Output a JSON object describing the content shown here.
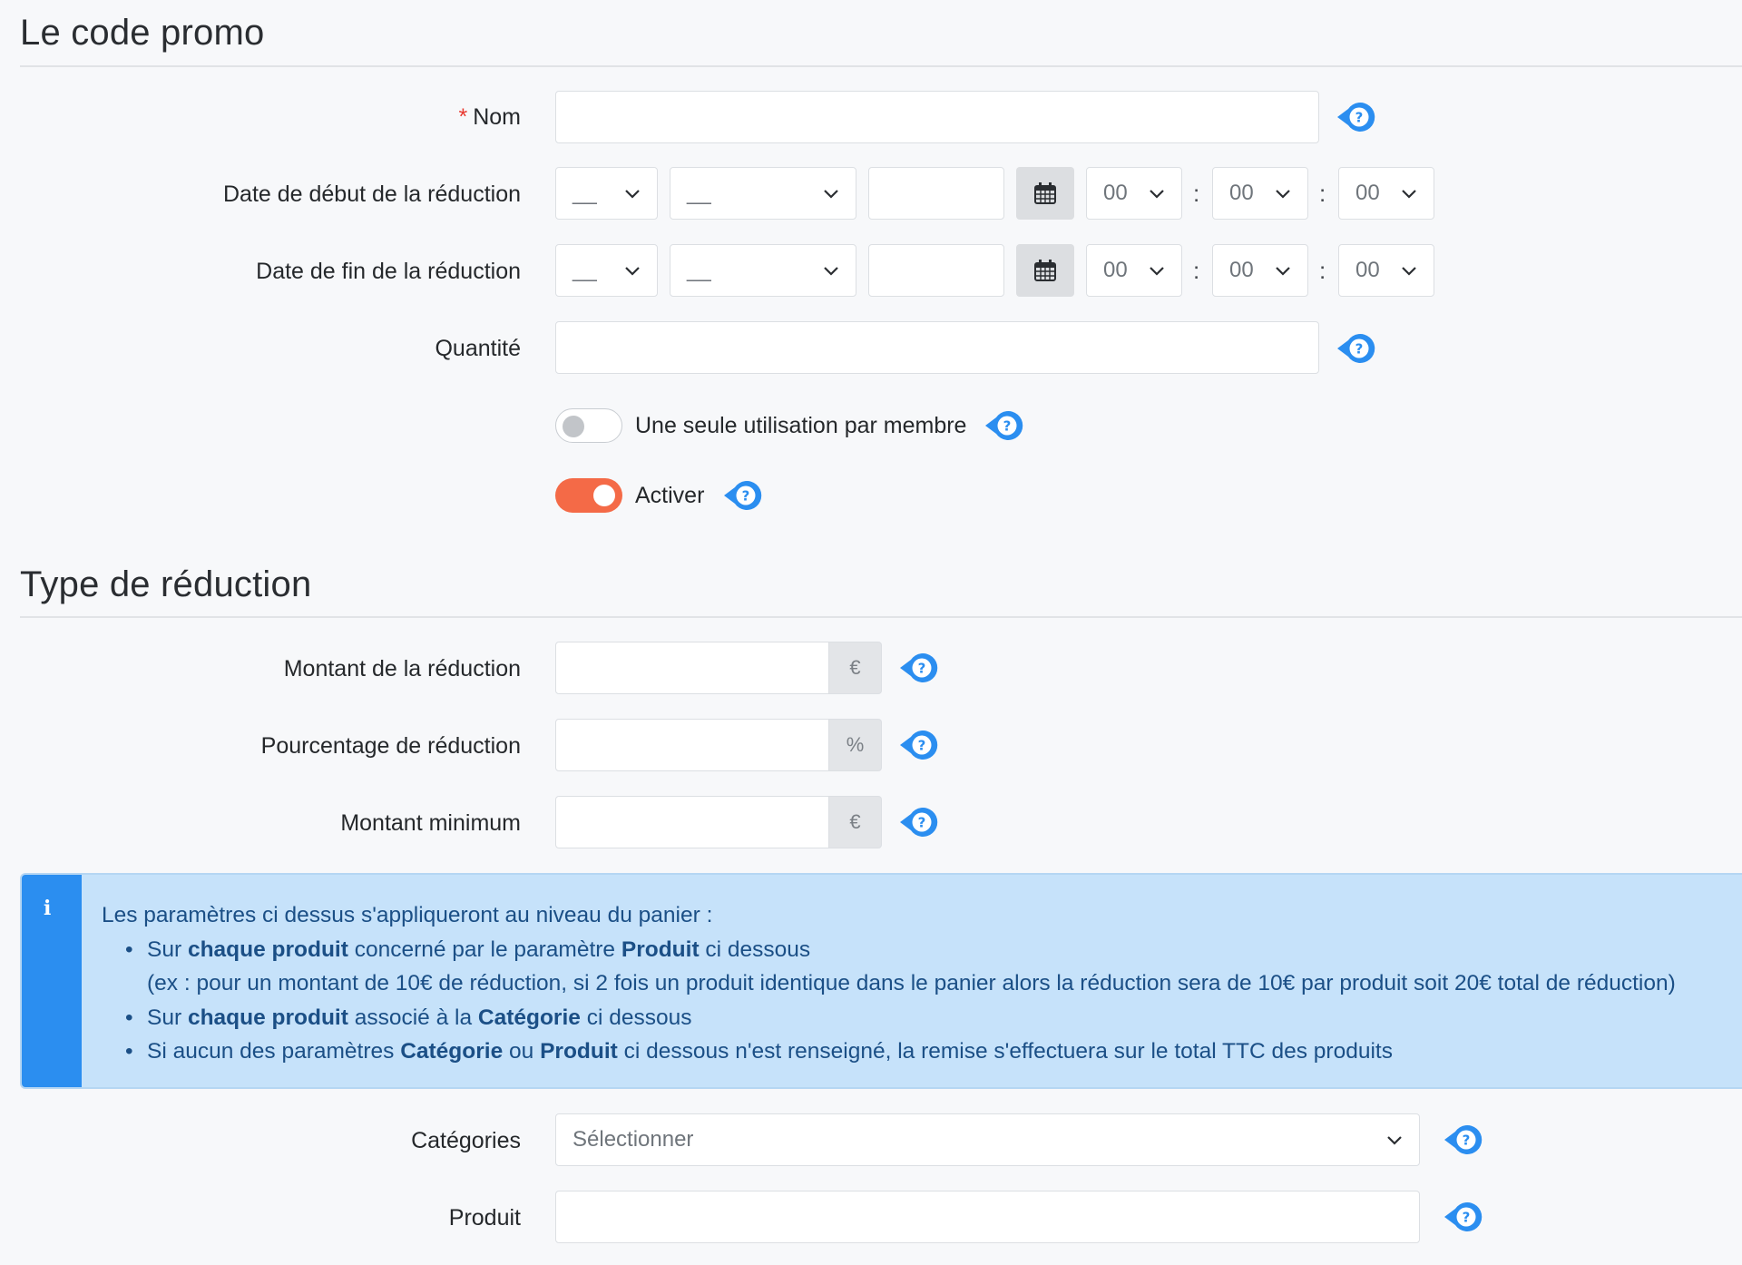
{
  "sections": {
    "promo_title": "Le code promo",
    "reduction_title": "Type de réduction"
  },
  "fields": {
    "nom": {
      "label": "Nom",
      "required_star": "*",
      "value": ""
    },
    "date_debut": {
      "label": "Date de début de la réduction",
      "day": "__",
      "month": "__",
      "year": "",
      "hour": "00",
      "minute": "00",
      "second": "00"
    },
    "date_fin": {
      "label": "Date de fin de la réduction",
      "day": "__",
      "month": "__",
      "year": "",
      "hour": "00",
      "minute": "00",
      "second": "00"
    },
    "quantite": {
      "label": "Quantité",
      "value": ""
    },
    "une_seule_utilisation": {
      "label": "Une seule utilisation par membre",
      "enabled": false
    },
    "activer": {
      "label": "Activer",
      "enabled": true
    },
    "montant_reduction": {
      "label": "Montant de la réduction",
      "value": "",
      "unit": "€"
    },
    "pourcentage_reduction": {
      "label": "Pourcentage de réduction",
      "value": "",
      "unit": "%"
    },
    "montant_minimum": {
      "label": "Montant minimum",
      "value": "",
      "unit": "€"
    },
    "categories": {
      "label": "Catégories",
      "placeholder": "Sélectionner"
    },
    "produit": {
      "label": "Produit",
      "value": ""
    }
  },
  "time_separator": ":",
  "info": {
    "icon": "info-icon",
    "intro": "Les paramètres ci dessus s'appliqueront au niveau du panier :",
    "b1_pre": "Sur ",
    "b1_bold1": "chaque produit",
    "b1_mid": " concerné par le paramètre ",
    "b1_bold2": "Produit",
    "b1_post": " ci dessous",
    "b1_example": "(ex : pour un montant de 10€ de réduction, si 2 fois un produit identique dans le panier alors la réduction sera de 10€ par produit soit 20€ total de réduction)",
    "b2_pre": "Sur ",
    "b2_bold1": "chaque produit",
    "b2_mid": " associé à la ",
    "b2_bold2": "Catégorie",
    "b2_post": " ci dessous",
    "b3_pre": "Si aucun des paramètres ",
    "b3_bold1": "Catégorie",
    "b3_mid": " ou ",
    "b3_bold2": "Produit",
    "b3_post": " ci dessous n'est renseigné, la remise s'effectuera sur le total TTC des produits"
  },
  "colors": {
    "accent_help": "#2b8ef0",
    "toggle_on": "#f46a47",
    "info_bg": "#c6e2fa",
    "info_bar": "#2b8ef0",
    "required": "#e8382f"
  }
}
